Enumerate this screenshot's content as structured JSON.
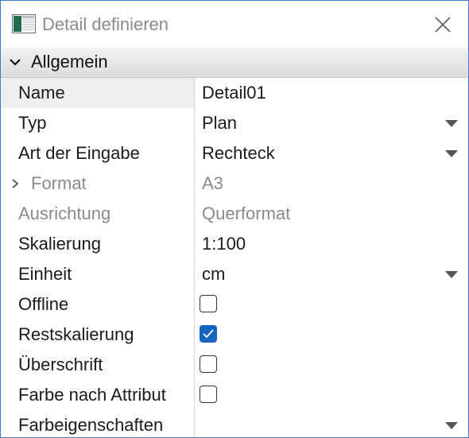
{
  "window": {
    "title": "Detail definieren",
    "app_icon": "table-app-icon",
    "close_icon": "close-icon"
  },
  "section": {
    "label": "Allgemein",
    "expanded": true,
    "icon": "chevron-down-icon"
  },
  "properties": [
    {
      "label": "Name",
      "value": "Detail01",
      "editor": "text",
      "selected": true
    },
    {
      "label": "Typ",
      "value": "Plan",
      "editor": "dropdown"
    },
    {
      "label": "Art der Eingabe",
      "value": "Rechteck",
      "editor": "dropdown"
    },
    {
      "label": "Format",
      "value": "A3",
      "editor": "readonly",
      "expandable": true,
      "disabled": true
    },
    {
      "label": "Ausrichtung",
      "value": "Querformat",
      "editor": "readonly",
      "disabled": true
    },
    {
      "label": "Skalierung",
      "value": "1:100",
      "editor": "text"
    },
    {
      "label": "Einheit",
      "value": "cm",
      "editor": "dropdown"
    },
    {
      "label": "Offline",
      "editor": "checkbox",
      "checked": false
    },
    {
      "label": "Restskalierung",
      "editor": "checkbox",
      "checked": true
    },
    {
      "label": "Überschrift",
      "editor": "checkbox",
      "checked": false
    },
    {
      "label": "Farbe nach Attribut",
      "editor": "checkbox",
      "checked": false
    },
    {
      "label": "Farbeigenschaften",
      "value": "",
      "editor": "dropdown"
    }
  ],
  "colors": {
    "accent": "#1565c0",
    "disabled_text": "#8a8a8a",
    "window_border": "#3a7bd5"
  }
}
